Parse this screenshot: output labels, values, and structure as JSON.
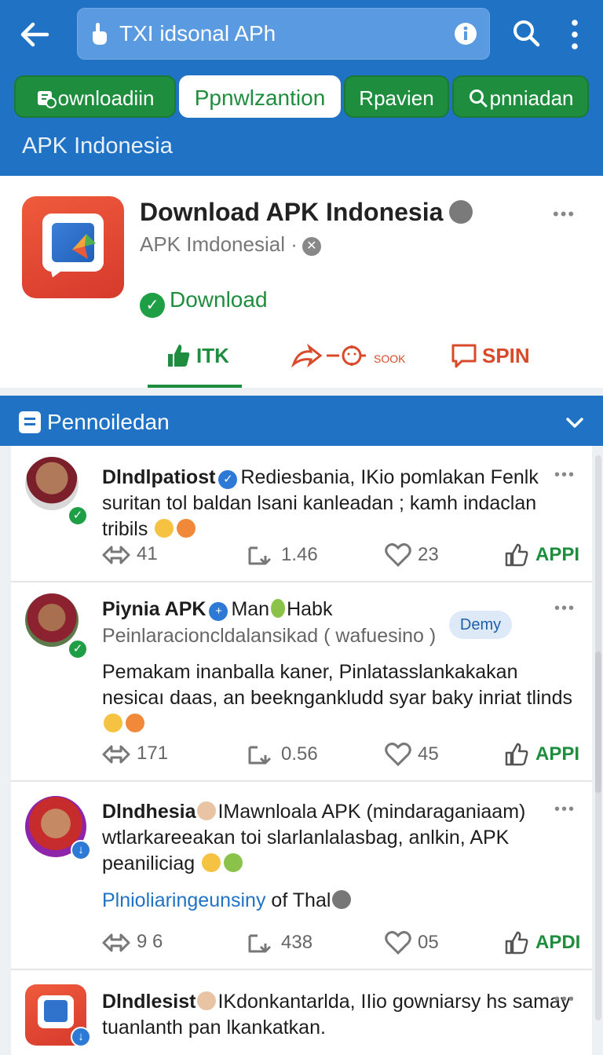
{
  "header": {
    "search_text": "TXI idsonal APh",
    "chips": [
      {
        "label": "ownloadiin",
        "active": false
      },
      {
        "label": "Ppnwlzantion",
        "active": true
      },
      {
        "label": "Rpavien",
        "active": false
      },
      {
        "label": "pnniadan",
        "active": false
      }
    ],
    "subtitle": "APK Indonesia"
  },
  "app": {
    "title": "Download APK Indonesia",
    "developer": "APK Imdonesial ·",
    "download_label": "Download",
    "actions": [
      {
        "label": "ITK",
        "icon": "thumbs-up-icon"
      },
      {
        "label": "SOOK",
        "icon": "share-icon"
      },
      {
        "label": "SPIN",
        "icon": "comment-icon"
      }
    ]
  },
  "section": {
    "title": "Pennoiledan"
  },
  "posts": [
    {
      "author": "Dlndlpatiost",
      "text_inline": "Rediesbania, IKio pomlakan Fenlk",
      "text": "suritan tol baldan lsani kanleadan ; kamh indaclan tribils",
      "stats": {
        "shares": "41",
        "reposts": "1.46",
        "likes": "23",
        "action": "APPI"
      }
    },
    {
      "author": "Piynia APK",
      "author_extra": "Man",
      "author_extra2": "Habk",
      "handle": "Peinlaracioncldalansikad ( wafuesino )",
      "tag": "Demy",
      "text": "Pemakam inanballa kaner, Pinlatasslankakakan nesicaı daas, an beekngankludd syar baky inriat tlinds",
      "stats": {
        "shares": "171",
        "reposts": "0.56",
        "likes": "45",
        "action": "APPI"
      }
    },
    {
      "author": "Dlndhesia",
      "author_extra": "IMawnloala APK (mindaraganiaam)",
      "text": "wtlarkareeakan toi slarlanlalasbag, anlkin, APK peaniliciag",
      "link": "Plnioliaringeunsiny",
      "link_suffix": "of Thal",
      "stats": {
        "shares": "9 6",
        "reposts": "438",
        "likes": "05",
        "action": "APDI"
      }
    },
    {
      "author": "Dlndlesist",
      "author_extra": "IKdonkantarlda, IIio gowniarsy hs",
      "text": "samay tuanlanth pan lkankatkan."
    }
  ],
  "colors": {
    "primary_blue": "#1f72c4",
    "green": "#1e8e3e",
    "red": "#d84a2a"
  }
}
